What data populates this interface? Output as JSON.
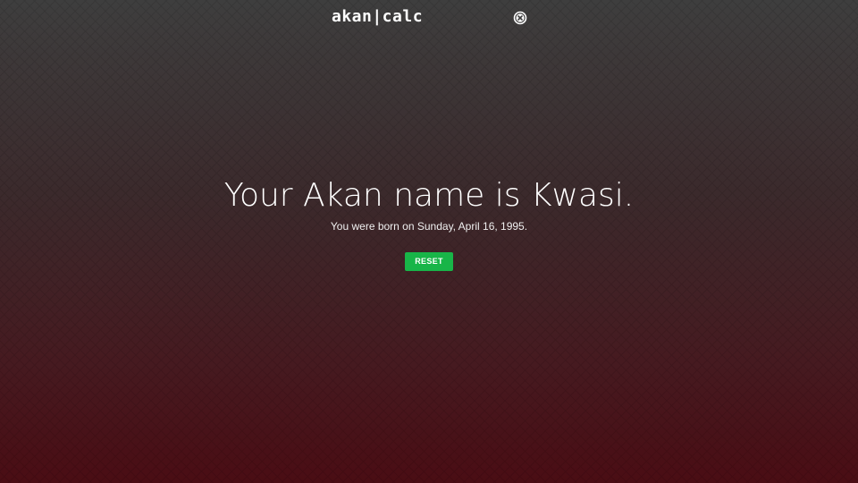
{
  "header": {
    "logo_text": "akan|calc",
    "close_icon": "close-circle-icon"
  },
  "result": {
    "title": "Your Akan name is Kwasi.",
    "subtitle": "You were born on Sunday, April 16, 1995.",
    "reset_label": "RESET"
  },
  "colors": {
    "background_top": "#3e3e3e",
    "background_bottom": "#4a0d14",
    "reset_button": "#18b548",
    "text": "#ffffff"
  }
}
